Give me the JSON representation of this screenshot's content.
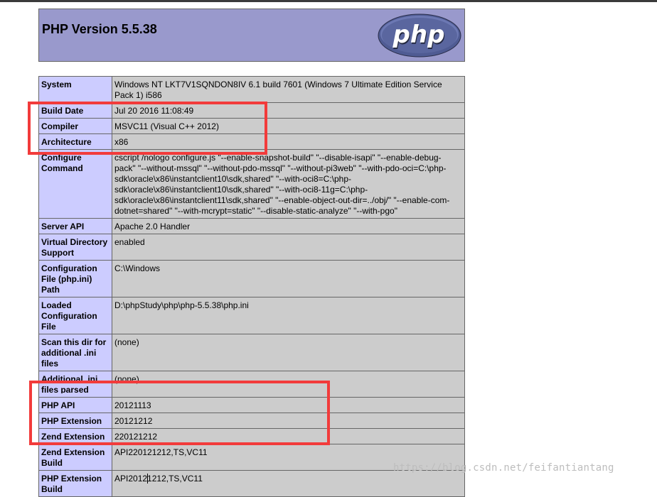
{
  "header": {
    "title": "PHP Version 5.5.38",
    "logo_text": "php"
  },
  "rows": [
    {
      "key": "System",
      "value": "Windows NT LKT7V1SQNDON8IV 6.1 build 7601 (Windows 7 Ultimate Edition Service Pack 1) i586"
    },
    {
      "key": "Build Date",
      "value": "Jul 20 2016 11:08:49"
    },
    {
      "key": "Compiler",
      "value": "MSVC11 (Visual C++ 2012)"
    },
    {
      "key": "Architecture",
      "value": "x86"
    },
    {
      "key": "Configure Command",
      "value": "cscript /nologo configure.js \"--enable-snapshot-build\" \"--disable-isapi\" \"--enable-debug-pack\" \"--without-mssql\" \"--without-pdo-mssql\" \"--without-pi3web\" \"--with-pdo-oci=C:\\php-sdk\\oracle\\x86\\instantclient10\\sdk,shared\" \"--with-oci8=C:\\php-sdk\\oracle\\x86\\instantclient10\\sdk,shared\" \"--with-oci8-11g=C:\\php-sdk\\oracle\\x86\\instantclient11\\sdk,shared\" \"--enable-object-out-dir=../obj/\" \"--enable-com-dotnet=shared\" \"--with-mcrypt=static\" \"--disable-static-analyze\" \"--with-pgo\""
    },
    {
      "key": "Server API",
      "value": "Apache 2.0 Handler"
    },
    {
      "key": "Virtual Directory Support",
      "value": "enabled"
    },
    {
      "key": "Configuration File (php.ini) Path",
      "value": "C:\\Windows"
    },
    {
      "key": "Loaded Configuration File",
      "value": "D:\\phpStudy\\php\\php-5.5.38\\php.ini"
    },
    {
      "key": "Scan this dir for additional .ini files",
      "value": "(none)"
    },
    {
      "key": "Additional .ini files parsed",
      "value": "(none)"
    },
    {
      "key": "PHP API",
      "value": "20121113"
    },
    {
      "key": "PHP Extension",
      "value": "20121212"
    },
    {
      "key": "Zend Extension",
      "value": "220121212"
    },
    {
      "key": "Zend Extension Build",
      "value": "API220121212,TS,VC11"
    },
    {
      "key": "PHP Extension Build",
      "value_before_caret": "API2012",
      "value_after_caret": "1212,TS,VC11"
    }
  ],
  "watermark": "https://blog.csdn.net/feifantiantang",
  "colors": {
    "header_bg": "#9999cc",
    "key_bg": "#ccccff",
    "value_bg": "#cccccc",
    "highlight": "#f23b3b"
  }
}
